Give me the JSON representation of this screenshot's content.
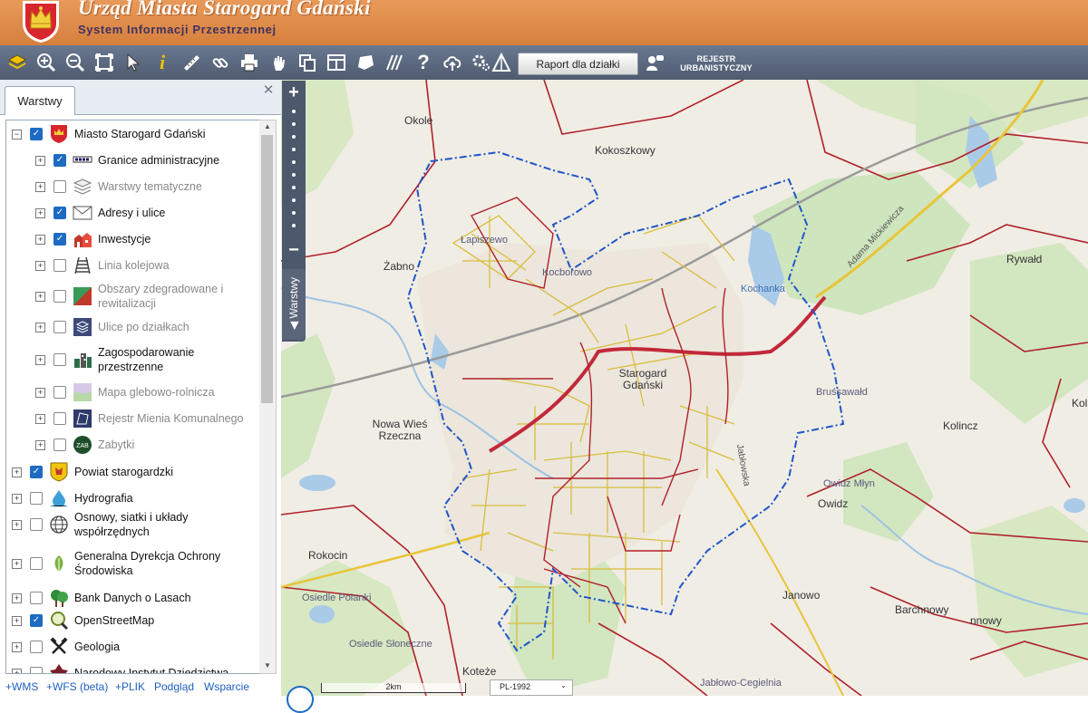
{
  "header": {
    "title": "Urząd Miasta Starogard Gdański",
    "subtitle": "System Informacji Przestrzennej"
  },
  "toolbar": {
    "icons": [
      "layers-icon",
      "zoom-in-icon",
      "zoom-out-icon",
      "zoom-extent-icon",
      "pointer-icon",
      "info-icon",
      "measure-icon",
      "link-icon",
      "print-icon",
      "pan-icon",
      "copy-icon",
      "layout-icon",
      "shape-icon",
      "hatch-icon",
      "help-icon",
      "upload-icon",
      "settings-icon",
      "triangle-icon"
    ],
    "raport_label": "Raport dla działki",
    "rejestr_line1": "REJESTR",
    "rejestr_line2": "URBANISTYCZNY"
  },
  "panel": {
    "tab_label": "Warstwy",
    "close_glyph": "✕",
    "layers": [
      {
        "label": "Miasto Starogard Gdański",
        "checked": true,
        "level": 0,
        "expanded": true,
        "grey": false,
        "icon": "crest-icon"
      },
      {
        "label": "Granice administracyjne",
        "checked": true,
        "level": 1,
        "grey": false,
        "icon": "boundary-line-icon"
      },
      {
        "label": "Warstwy tematyczne",
        "checked": false,
        "level": 1,
        "grey": true,
        "icon": "stack-icon"
      },
      {
        "label": "Adresy i ulice",
        "checked": true,
        "level": 1,
        "grey": false,
        "icon": "envelope-icon"
      },
      {
        "label": "Inwestycje",
        "checked": true,
        "level": 1,
        "grey": false,
        "icon": "buildings-icon"
      },
      {
        "label": "Linia kolejowa",
        "checked": false,
        "level": 1,
        "grey": true,
        "icon": "railway-icon"
      },
      {
        "label": "Obszary zdegradowane i rewitalizacji",
        "checked": false,
        "level": 1,
        "grey": true,
        "icon": "degraded-area-icon"
      },
      {
        "label": "Ulice po działkach",
        "checked": false,
        "level": 1,
        "grey": true,
        "icon": "street-layers-icon"
      },
      {
        "label": "Zagospodarowanie przestrzenne",
        "checked": false,
        "level": 1,
        "grey": false,
        "icon": "city-plan-icon"
      },
      {
        "label": "Mapa glebowo-rolnicza",
        "checked": false,
        "level": 1,
        "grey": true,
        "icon": "soil-map-icon"
      },
      {
        "label": "Rejestr Mienia Komunalnego",
        "checked": false,
        "level": 1,
        "grey": true,
        "icon": "property-register-icon"
      },
      {
        "label": "Zabytki",
        "checked": false,
        "level": 1,
        "grey": true,
        "icon": "monument-icon"
      },
      {
        "label": "Powiat starogardzki",
        "checked": true,
        "level": 0,
        "grey": false,
        "icon": "county-crest-icon"
      },
      {
        "label": "Hydrografia",
        "checked": false,
        "level": 0,
        "grey": false,
        "icon": "water-drop-icon"
      },
      {
        "label": "Osnowy, siatki i układy współrzędnych",
        "checked": false,
        "level": 0,
        "grey": false,
        "icon": "globe-grid-icon"
      },
      {
        "label": "Generalna Dyrekcja Ochrony Środowiska",
        "checked": false,
        "level": 0,
        "grey": false,
        "icon": "leaf-icon"
      },
      {
        "label": "Bank Danych o Lasach",
        "checked": false,
        "level": 0,
        "grey": false,
        "icon": "trees-icon"
      },
      {
        "label": "OpenStreetMap",
        "checked": true,
        "level": 0,
        "grey": false,
        "icon": "osm-magnifier-icon"
      },
      {
        "label": "Geologia",
        "checked": false,
        "level": 0,
        "grey": false,
        "icon": "hammers-icon"
      },
      {
        "label": "Narodowy Instytut Dziedzictwa",
        "checked": false,
        "level": 0,
        "grey": false,
        "icon": "heritage-icon"
      }
    ]
  },
  "footer_links": [
    "+WMS",
    "+WFS (beta)",
    "+PLIK",
    "Podgląd",
    "Wsparcie"
  ],
  "map": {
    "zoom_in": "+",
    "zoom_out": "−",
    "side_tab": "◀ Warstwy",
    "places": [
      "Okole",
      "Kokoszkowy",
      "Żabno",
      "Łapiszewo",
      "Kocborowo",
      "Kochanka",
      "Rywałd",
      "Adama Mickiewicza",
      "Starogard Gdański",
      "Nowa Wieś Rzeczna",
      "Bruśsawałd",
      "Kolincz",
      "Owidz Młyn",
      "Owidz",
      "Rokocin",
      "Osiedle Polanki",
      "Janowo",
      "Barchnowy",
      "Osiedle Słoneczne",
      "Koteże",
      "Jabłowo-Cegielnia",
      "Jabłowska",
      "Kolin",
      "nnowy"
    ],
    "scale_label": "2km",
    "crs_label": "PL-1992"
  }
}
